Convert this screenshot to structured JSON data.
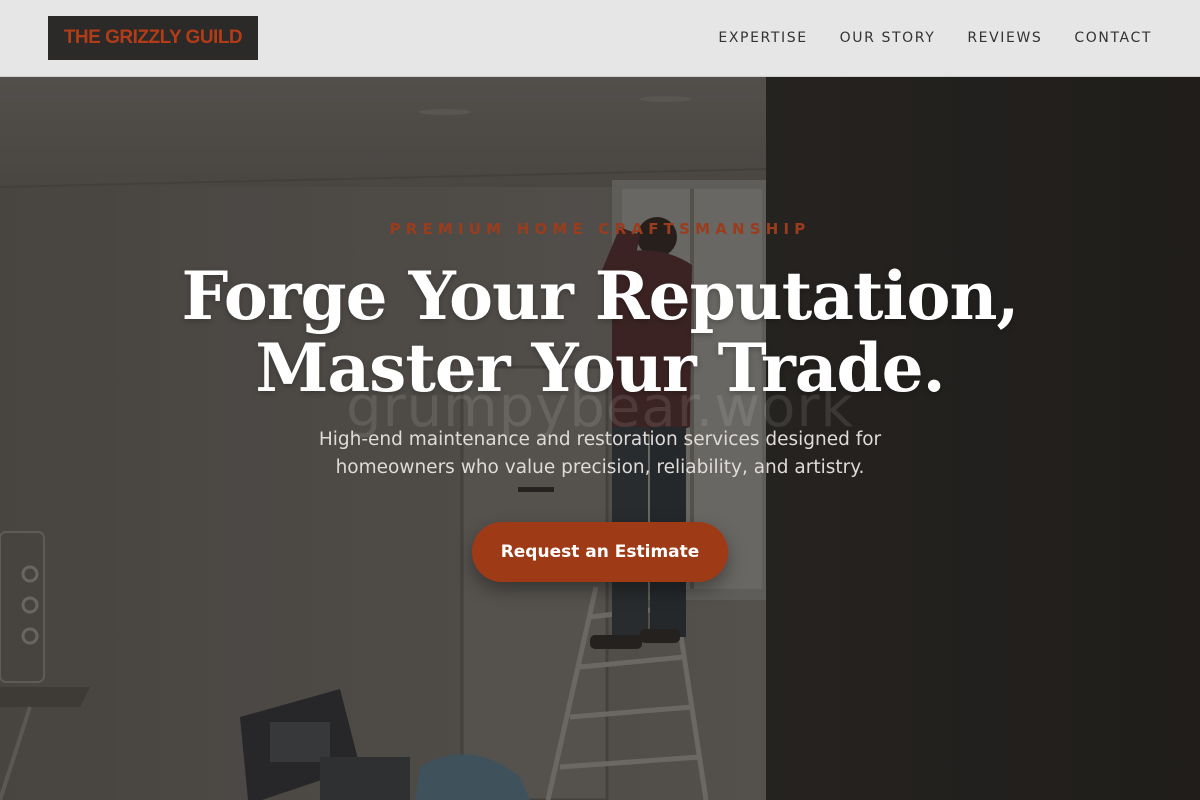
{
  "header": {
    "logo_text": "THE GRIZZLY GUILD",
    "nav": [
      {
        "label": "EXPERTISE"
      },
      {
        "label": "OUR STORY"
      },
      {
        "label": "REVIEWS"
      },
      {
        "label": "CONTACT"
      }
    ]
  },
  "hero": {
    "eyebrow": "PREMIUM HOME CRAFTSMANSHIP",
    "headline_line1": "Forge Your Reputation,",
    "headline_line2": "Master Your Trade.",
    "watermark": "grumpybear.work",
    "subhead": "High-end maintenance and restoration services designed for homeowners who value precision, reliability, and artistry.",
    "cta_label": "Request an Estimate",
    "background_image": "photo of a handyman on a ladder working at a window in a bright room"
  },
  "colors": {
    "brand_rust": "#9f3a17",
    "logo_bg": "#2b2a28",
    "header_bg": "#e6e6e6"
  }
}
